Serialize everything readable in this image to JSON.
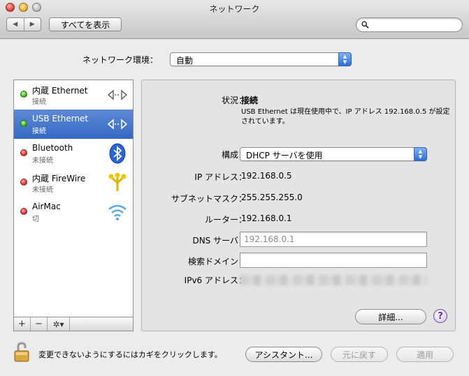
{
  "window": {
    "title": "ネットワーク"
  },
  "toolbar": {
    "back_label": "◀",
    "forward_label": "▶",
    "show_all_label": "すべてを表示",
    "search_placeholder": ""
  },
  "location": {
    "label": "ネットワーク環境：",
    "value": "自動"
  },
  "services": [
    {
      "name": "内蔵 Ethernet",
      "status": "接続",
      "status_color": "green",
      "icon": "ethernet-icon",
      "selected": false
    },
    {
      "name": "USB Ethernet",
      "status": "接続",
      "status_color": "green",
      "icon": "ethernet-icon",
      "selected": true
    },
    {
      "name": "Bluetooth",
      "status": "未接続",
      "status_color": "red",
      "icon": "bluetooth-icon",
      "selected": false
    },
    {
      "name": "内蔵 FireWire",
      "status": "未接続",
      "status_color": "red",
      "icon": "firewire-icon",
      "selected": false
    },
    {
      "name": "AirMac",
      "status": "切",
      "status_color": "red",
      "icon": "wifi-icon",
      "selected": false
    }
  ],
  "sidebar_tools": {
    "add": "+",
    "remove": "−",
    "gear": "✲▾"
  },
  "detail": {
    "status_label": "状況：",
    "status_value": "接続",
    "status_description": "USB Ethernet は現在使用中で、IP アドレス 192.168.0.5 が設定されています。",
    "configure_label": "構成：",
    "configure_value": "DHCP サーバを使用",
    "ip_label": "IP アドレス：",
    "ip_value": "192.168.0.5",
    "subnet_label": "サブネットマスク：",
    "subnet_value": "255.255.255.0",
    "router_label": "ルーター：",
    "router_value": "192.168.0.1",
    "dns_label": "DNS サーバ：",
    "dns_placeholder": "192.168.0.1",
    "search_domains_label": "検索ドメイン：",
    "search_domains_value": "",
    "ipv6_label": "IPv6 アドレス：",
    "advanced_label": "詳細...",
    "help_label": "?"
  },
  "footer": {
    "lock_text": "変更できないようにするにはカギをクリックします。",
    "assistant_label": "アシスタント...",
    "revert_label": "元に戻す",
    "apply_label": "適用"
  },
  "colors": {
    "selection": "#3a6cc6",
    "accent_popup": "#2a6fd9"
  }
}
